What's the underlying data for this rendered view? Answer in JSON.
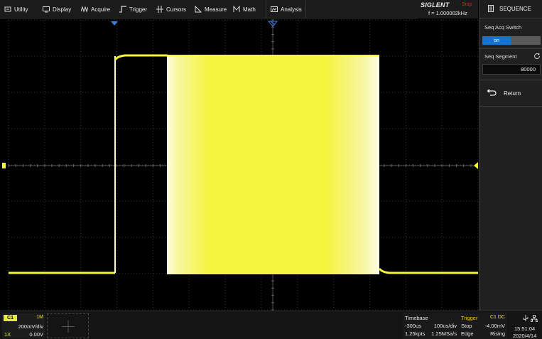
{
  "menu": {
    "items": [
      {
        "label": "Utility",
        "icon": "utility-icon"
      },
      {
        "label": "Display",
        "icon": "display-icon"
      },
      {
        "label": "Acquire",
        "icon": "acquire-icon"
      },
      {
        "label": "Trigger",
        "icon": "trigger-icon"
      },
      {
        "label": "Cursors",
        "icon": "cursors-icon"
      },
      {
        "label": "Measure",
        "icon": "measure-icon"
      },
      {
        "label": "Math",
        "icon": "math-icon"
      },
      {
        "label": "Analysis",
        "icon": "analysis-icon"
      }
    ]
  },
  "brand": {
    "logo": "SIGLENT",
    "status": "Stop",
    "frequency": "f = 1.000002kHz"
  },
  "panel": {
    "title": "SEQUENCE",
    "seq_acq_switch_label": "Seq Acq Switch",
    "seq_acq_switch_value": "on",
    "seq_segment_label": "Seq Segment",
    "seq_segment_value": "80000",
    "return_label": "Return"
  },
  "channel1": {
    "tag": "C1",
    "impedance": "1M",
    "scale": "200mV/div",
    "probe": "1X",
    "offset": "0.00V"
  },
  "timebase": {
    "title": "Timebase",
    "delay": "-300us",
    "scale": "100us/div",
    "points": "1.25kpts",
    "sample_rate": "1.25MSa/s"
  },
  "trigger": {
    "title": "Trigger",
    "source": "C1 DC",
    "mode": "Stop",
    "level": "-4.00mV",
    "type": "Edge",
    "slope": "Rising"
  },
  "clock": {
    "time": "15:51:04",
    "date": "2020/4/14"
  },
  "colors": {
    "trace": "#f5f53a",
    "accent": "#1474d4",
    "status_stop": "#e02020",
    "marker_blue": "#3a7fe0"
  }
}
